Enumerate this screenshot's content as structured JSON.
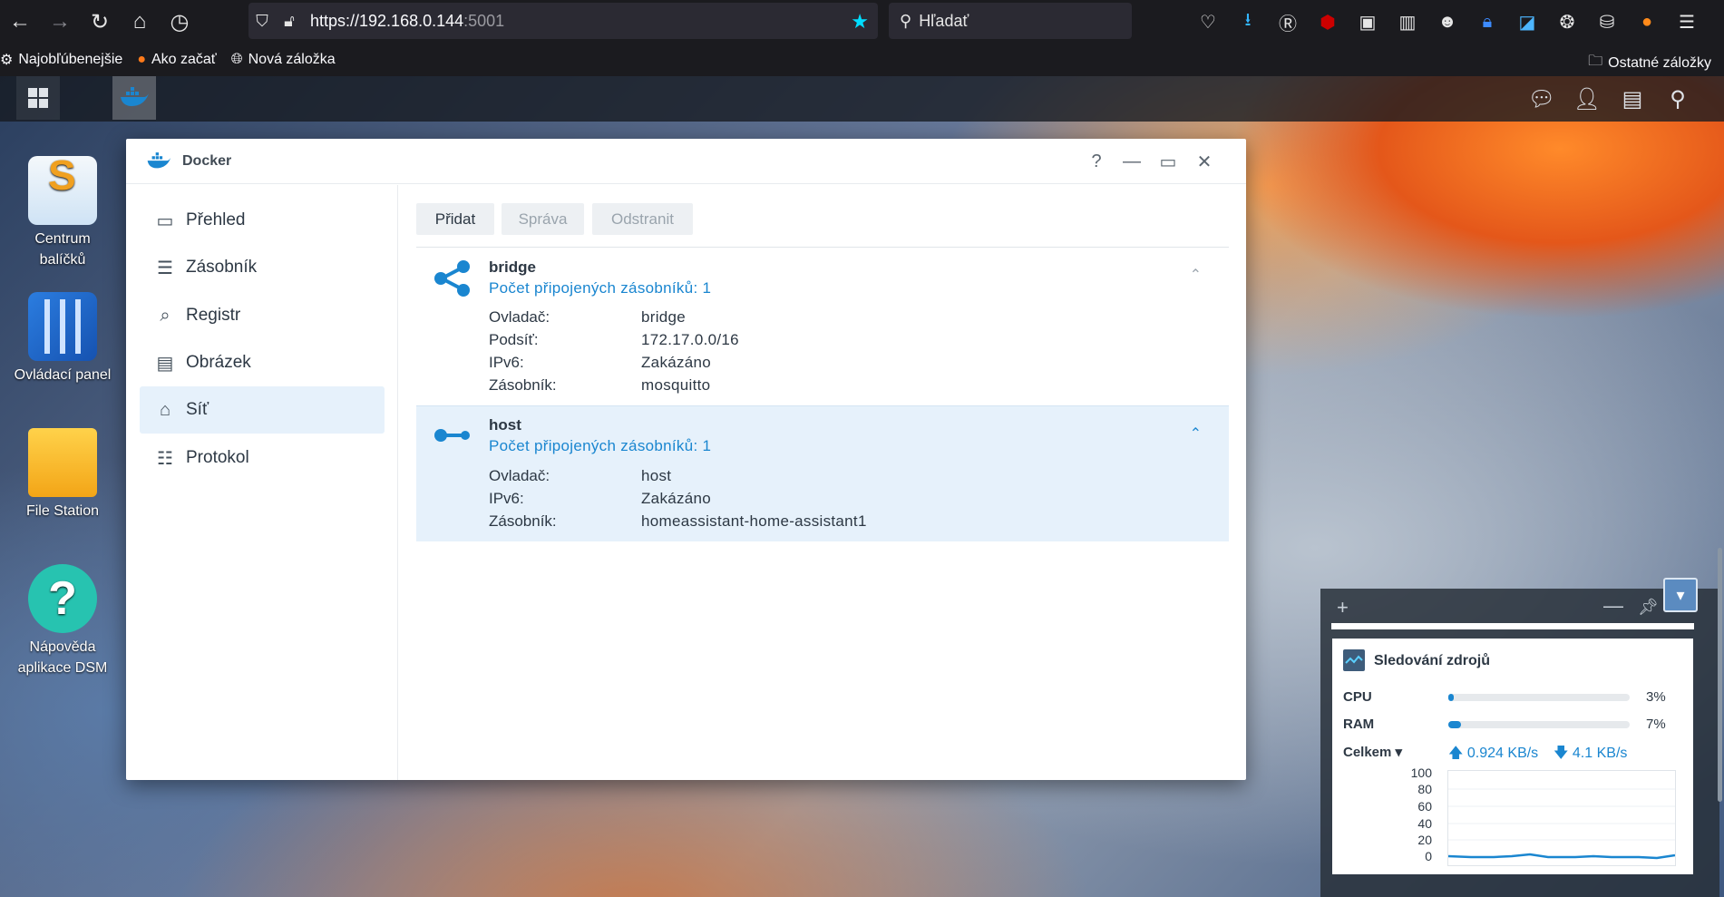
{
  "browser": {
    "url_host": "https://192.168.0.144",
    "url_port": ":5001",
    "search_placeholder": "Hľadať"
  },
  "bookmarks": {
    "items": [
      "Najobľúbenejšie",
      "Ako začať",
      "Nová záložka"
    ],
    "other": "Ostatné záložky"
  },
  "desktop": {
    "icons": [
      "Centrum balíčků",
      "Ovládací panel",
      "File Station",
      "Nápověda aplikace DSM"
    ]
  },
  "window": {
    "title": "Docker",
    "help": "?",
    "minimize": "—",
    "maximize": "▭",
    "close": "✕"
  },
  "sidebar": {
    "items": [
      {
        "label": "Přehled",
        "icon": "overview-icon"
      },
      {
        "label": "Zásobník",
        "icon": "container-icon"
      },
      {
        "label": "Registr",
        "icon": "registry-icon"
      },
      {
        "label": "Obrázek",
        "icon": "image-icon"
      },
      {
        "label": "Síť",
        "icon": "network-icon",
        "active": true
      },
      {
        "label": "Protokol",
        "icon": "log-icon"
      }
    ]
  },
  "toolbar": {
    "add": "Přidat",
    "manage": "Správa",
    "remove": "Odstranit"
  },
  "networks": [
    {
      "name": "bridge",
      "count_text": "Počet připojených zásobníků: 1",
      "rows": [
        {
          "label": "Ovladač:",
          "value": "bridge"
        },
        {
          "label": "Podsíť:",
          "value": "172.17.0.0/16"
        },
        {
          "label": "IPv6:",
          "value": "Zakázáno"
        },
        {
          "label": "Zásobník:",
          "value": "mosquitto"
        }
      ]
    },
    {
      "name": "host",
      "count_text": "Počet připojených zásobníků: 1",
      "rows": [
        {
          "label": "Ovladač:",
          "value": "host"
        },
        {
          "label": "IPv6:",
          "value": "Zakázáno"
        },
        {
          "label": "Zásobník:",
          "value": "homeassistant-home-assistant1"
        }
      ]
    }
  ],
  "resource_monitor": {
    "title": "Sledování zdrojů",
    "cpu_label": "CPU",
    "cpu_pct": "3%",
    "cpu_value": 3,
    "ram_label": "RAM",
    "ram_pct": "7%",
    "ram_value": 7,
    "total_label": "Celkem ▾",
    "upload": "0.924 KB/s",
    "download": "4.1 KB/s",
    "ticks": [
      "100",
      "80",
      "60",
      "40",
      "20",
      "0"
    ]
  },
  "colors": {
    "accent": "#1a86d0",
    "selected_bg": "#e6f1fb"
  }
}
